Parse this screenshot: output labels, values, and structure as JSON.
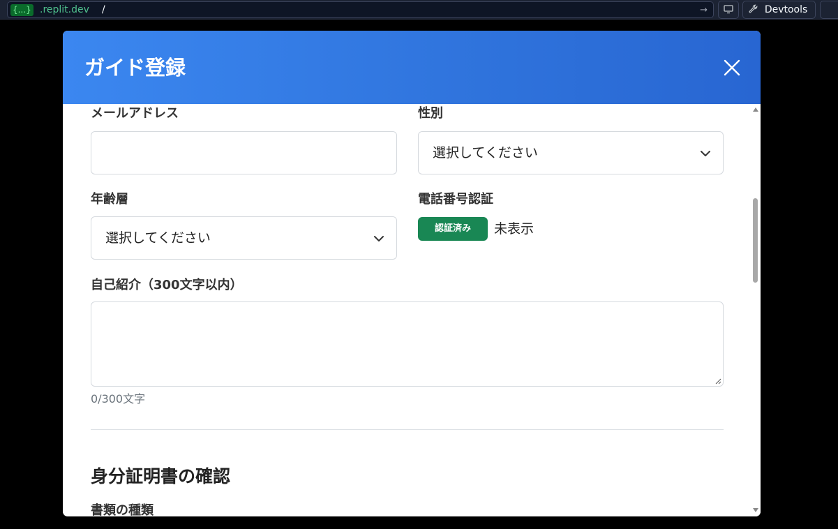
{
  "browser": {
    "url_chip": "{...}",
    "url_domain": ".replit.dev",
    "url_path": "/",
    "go_icon": "arrow-right-icon",
    "screen_icon": "monitor-icon",
    "devtools_label": "Devtools",
    "devtools_icon": "wrench-icon"
  },
  "modal": {
    "title": "ガイド登録",
    "close_icon": "close-icon",
    "header_colors": [
      "#3b87f0",
      "#2866d2"
    ],
    "fields": {
      "email_label": "メールアドレス",
      "email_value": "",
      "gender_label": "性別",
      "gender_value": "選択してください",
      "age_label": "年齢層",
      "age_value": "選択してください",
      "phone_label": "電話番号認証",
      "phone_badge": "認証済み",
      "phone_note": "未表示",
      "bio_label": "自己紹介（300文字以内）",
      "bio_value": "",
      "bio_counter": "0/300文字"
    },
    "id_section": {
      "title": "身分証明書の確認",
      "doc_type_label": "書類の種類"
    },
    "badge_color": "#198754"
  }
}
